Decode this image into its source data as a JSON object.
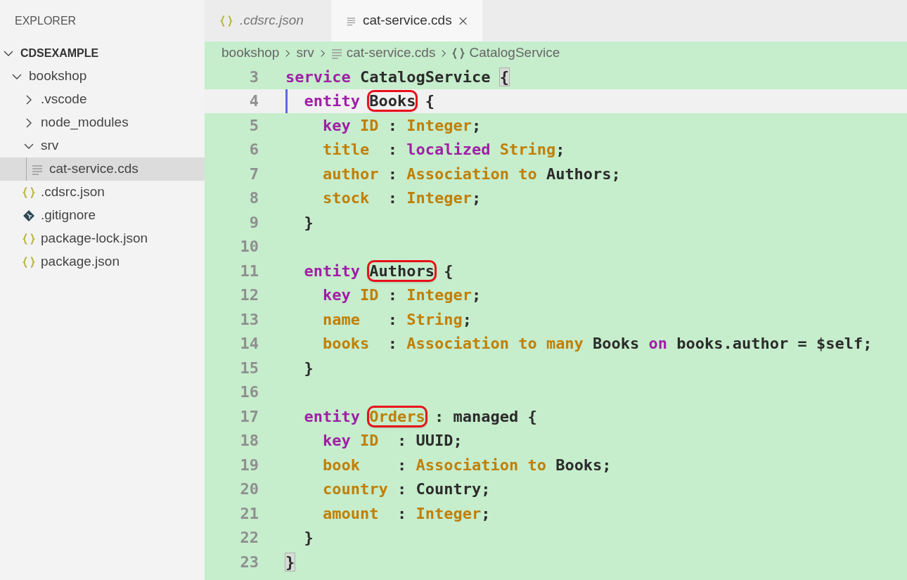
{
  "sidebar": {
    "title": "EXPLORER",
    "items": [
      {
        "label": "CDSEXAMPLE",
        "kind": "root",
        "expanded": true,
        "selected": false,
        "children": [
          {
            "label": "bookshop",
            "kind": "folder",
            "expanded": true,
            "selected": false,
            "children": [
              {
                "label": ".vscode",
                "kind": "folder",
                "expanded": false,
                "selected": false
              },
              {
                "label": "node_modules",
                "kind": "folder",
                "expanded": false,
                "selected": false
              },
              {
                "label": "srv",
                "kind": "folder",
                "expanded": true,
                "selected": false,
                "children": [
                  {
                    "label": "cat-service.cds",
                    "kind": "text",
                    "selected": true
                  }
                ]
              },
              {
                "label": ".cdsrc.json",
                "kind": "json",
                "selected": false
              },
              {
                "label": ".gitignore",
                "kind": "git",
                "selected": false
              },
              {
                "label": "package-lock.json",
                "kind": "json",
                "selected": false
              },
              {
                "label": "package.json",
                "kind": "json",
                "selected": false
              }
            ]
          }
        ]
      }
    ]
  },
  "tabs": [
    {
      "label": ".cdsrc.json",
      "kind": "json",
      "preview": true,
      "selected": false
    },
    {
      "label": "cat-service.cds",
      "kind": "text",
      "preview": false,
      "selected": true
    }
  ],
  "breadcrumb": [
    {
      "label": "bookshop",
      "kind": "plain"
    },
    {
      "label": "srv",
      "kind": "plain"
    },
    {
      "label": "cat-service.cds",
      "kind": "text"
    },
    {
      "label": "CatalogService",
      "kind": "symbol"
    }
  ],
  "editor": {
    "lines": [
      {
        "number": "3",
        "current": false,
        "tokens": [
          {
            "text": "service",
            "kind": "keyword"
          },
          {
            "text": " CatalogService ",
            "kind": "plain"
          },
          {
            "text": "{",
            "kind": "plain",
            "matched": true
          }
        ]
      },
      {
        "number": "4",
        "current": true,
        "tokens": [
          {
            "text": "  entity ",
            "kind": "keyword"
          },
          {
            "text": "Books",
            "kind": "plain",
            "boxed": true
          },
          {
            "text": " {",
            "kind": "plain"
          }
        ]
      },
      {
        "number": "5",
        "current": false,
        "tokens": [
          {
            "text": "    key ",
            "kind": "keyword"
          },
          {
            "text": "ID",
            "kind": "type"
          },
          {
            "text": " : ",
            "kind": "plain"
          },
          {
            "text": "Integer",
            "kind": "type"
          },
          {
            "text": ";",
            "kind": "plain"
          }
        ]
      },
      {
        "number": "6",
        "current": false,
        "tokens": [
          {
            "text": "    title",
            "kind": "type"
          },
          {
            "text": "  : ",
            "kind": "plain"
          },
          {
            "text": "localized ",
            "kind": "keyword"
          },
          {
            "text": "String",
            "kind": "type"
          },
          {
            "text": ";",
            "kind": "plain"
          }
        ]
      },
      {
        "number": "7",
        "current": false,
        "tokens": [
          {
            "text": "    author",
            "kind": "type"
          },
          {
            "text": " : ",
            "kind": "plain"
          },
          {
            "text": "Association to",
            "kind": "type"
          },
          {
            "text": " Authors;",
            "kind": "plain"
          }
        ]
      },
      {
        "number": "8",
        "current": false,
        "tokens": [
          {
            "text": "    stock",
            "kind": "type"
          },
          {
            "text": "  : ",
            "kind": "plain"
          },
          {
            "text": "Integer",
            "kind": "type"
          },
          {
            "text": ";",
            "kind": "plain"
          }
        ]
      },
      {
        "number": "9",
        "current": false,
        "tokens": [
          {
            "text": "  }",
            "kind": "plain"
          }
        ]
      },
      {
        "number": "10",
        "current": false
      },
      {
        "number": "11",
        "current": false,
        "tokens": [
          {
            "text": "  entity ",
            "kind": "keyword"
          },
          {
            "text": "Authors",
            "kind": "plain",
            "boxed": true
          },
          {
            "text": " {",
            "kind": "plain"
          }
        ]
      },
      {
        "number": "12",
        "current": false,
        "tokens": [
          {
            "text": "    key ",
            "kind": "keyword"
          },
          {
            "text": "ID",
            "kind": "type"
          },
          {
            "text": " : ",
            "kind": "plain"
          },
          {
            "text": "Integer",
            "kind": "type"
          },
          {
            "text": ";",
            "kind": "plain"
          }
        ]
      },
      {
        "number": "13",
        "current": false,
        "tokens": [
          {
            "text": "    name",
            "kind": "type"
          },
          {
            "text": "   : ",
            "kind": "plain"
          },
          {
            "text": "String",
            "kind": "type"
          },
          {
            "text": ";",
            "kind": "plain"
          }
        ]
      },
      {
        "number": "14",
        "current": false,
        "tokens": [
          {
            "text": "    books",
            "kind": "type"
          },
          {
            "text": "  : ",
            "kind": "plain"
          },
          {
            "text": "Association to many",
            "kind": "type"
          },
          {
            "text": " Books ",
            "kind": "plain"
          },
          {
            "text": "on",
            "kind": "keyword"
          },
          {
            "text": " books.author = $self;",
            "kind": "plain"
          }
        ]
      },
      {
        "number": "15",
        "current": false,
        "tokens": [
          {
            "text": "  }",
            "kind": "plain"
          }
        ]
      },
      {
        "number": "16",
        "current": false
      },
      {
        "number": "17",
        "current": false,
        "tokens": [
          {
            "text": "  entity ",
            "kind": "keyword"
          },
          {
            "text": "Orders",
            "kind": "type",
            "boxed": true
          },
          {
            "text": " : managed {",
            "kind": "plain"
          }
        ]
      },
      {
        "number": "18",
        "current": false,
        "tokens": [
          {
            "text": "    key ",
            "kind": "keyword"
          },
          {
            "text": "ID",
            "kind": "type"
          },
          {
            "text": "  : UUID;",
            "kind": "plain"
          }
        ]
      },
      {
        "number": "19",
        "current": false,
        "tokens": [
          {
            "text": "    book",
            "kind": "type"
          },
          {
            "text": "    : ",
            "kind": "plain"
          },
          {
            "text": "Association to",
            "kind": "type"
          },
          {
            "text": " Books;",
            "kind": "plain"
          }
        ]
      },
      {
        "number": "20",
        "current": false,
        "tokens": [
          {
            "text": "    country",
            "kind": "type"
          },
          {
            "text": " : Country;",
            "kind": "plain"
          }
        ]
      },
      {
        "number": "21",
        "current": false,
        "tokens": [
          {
            "text": "    amount",
            "kind": "type"
          },
          {
            "text": "  : ",
            "kind": "plain"
          },
          {
            "text": "Integer",
            "kind": "type"
          },
          {
            "text": ";",
            "kind": "plain"
          }
        ]
      },
      {
        "number": "22",
        "current": false,
        "tokens": [
          {
            "text": "  }",
            "kind": "plain"
          }
        ]
      },
      {
        "number": "23",
        "current": false,
        "tokens": [
          {
            "text": "}",
            "kind": "plain",
            "matched": true
          }
        ]
      }
    ]
  }
}
